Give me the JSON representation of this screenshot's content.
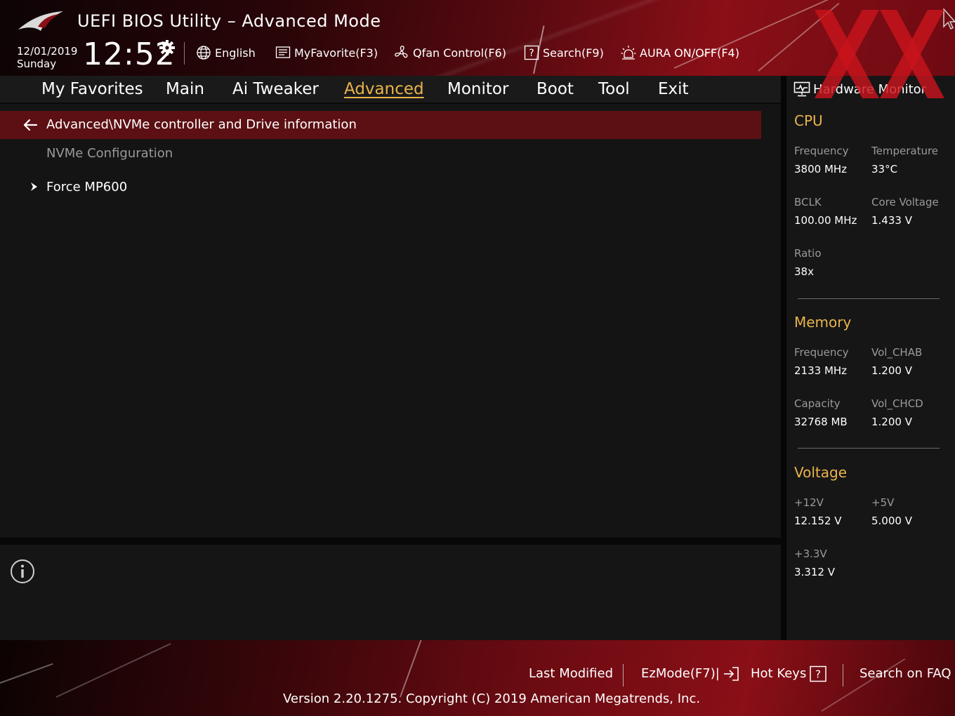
{
  "header": {
    "title": "UEFI BIOS Utility – Advanced Mode",
    "date": "12/01/2019",
    "day": "Sunday",
    "time": "12:52",
    "tools": {
      "language": "English",
      "favorite": "MyFavorite(F3)",
      "qfan": "Qfan Control(F6)",
      "search": "Search(F9)",
      "aura": "AURA ON/OFF(F4)"
    }
  },
  "nav": {
    "tabs": [
      "My Favorites",
      "Main",
      "Ai Tweaker",
      "Advanced",
      "Monitor",
      "Boot",
      "Tool",
      "Exit"
    ],
    "active": "Advanced"
  },
  "main": {
    "breadcrumb": "Advanced\\NVMe controller and Drive information",
    "section_label": "NVMe Configuration",
    "items": [
      {
        "label": "Force MP600"
      }
    ]
  },
  "hardware_monitor": {
    "title": "Hardware Monitor",
    "cpu": {
      "heading": "CPU",
      "frequency": {
        "label": "Frequency",
        "value": "3800 MHz"
      },
      "temperature": {
        "label": "Temperature",
        "value": "33°C"
      },
      "bclk": {
        "label": "BCLK",
        "value": "100.00 MHz"
      },
      "core_voltage": {
        "label": "Core Voltage",
        "value": "1.433 V"
      },
      "ratio": {
        "label": "Ratio",
        "value": "38x"
      }
    },
    "memory": {
      "heading": "Memory",
      "frequency": {
        "label": "Frequency",
        "value": "2133 MHz"
      },
      "vol_chab": {
        "label": "Vol_CHAB",
        "value": "1.200 V"
      },
      "capacity": {
        "label": "Capacity",
        "value": "32768 MB"
      },
      "vol_chcd": {
        "label": "Vol_CHCD",
        "value": "1.200 V"
      }
    },
    "voltage": {
      "heading": "Voltage",
      "v12": {
        "label": "+12V",
        "value": "12.152 V"
      },
      "v5": {
        "label": "+5V",
        "value": "5.000 V"
      },
      "v33": {
        "label": "+3.3V",
        "value": "3.312 V"
      }
    }
  },
  "footer": {
    "last_modified": "Last Modified",
    "ezmode": "EzMode(F7)|",
    "hot_keys": "Hot Keys",
    "search_faq": "Search on FAQ",
    "copyright": "Version 2.20.1275. Copyright (C) 2019 American Megatrends, Inc."
  },
  "colors": {
    "accent": "#e9b44c",
    "breadcrumb_bg": "#5c1014",
    "panel_bg": "#141414",
    "brand_red": "#8a0f17"
  },
  "icons": {
    "logo": "rog-eye-logo",
    "settings": "gear-icon",
    "language": "globe-icon",
    "favorite": "favorite-list-icon",
    "qfan": "fan-icon",
    "search": "question-box-icon",
    "aura": "aura-light-icon",
    "back": "arrow-left-icon",
    "item": "chevron-right-icon",
    "info": "info-icon",
    "monitor": "monitor-icon",
    "ezmode": "exit-arrow-icon",
    "hot_keys": "question-box-icon"
  }
}
